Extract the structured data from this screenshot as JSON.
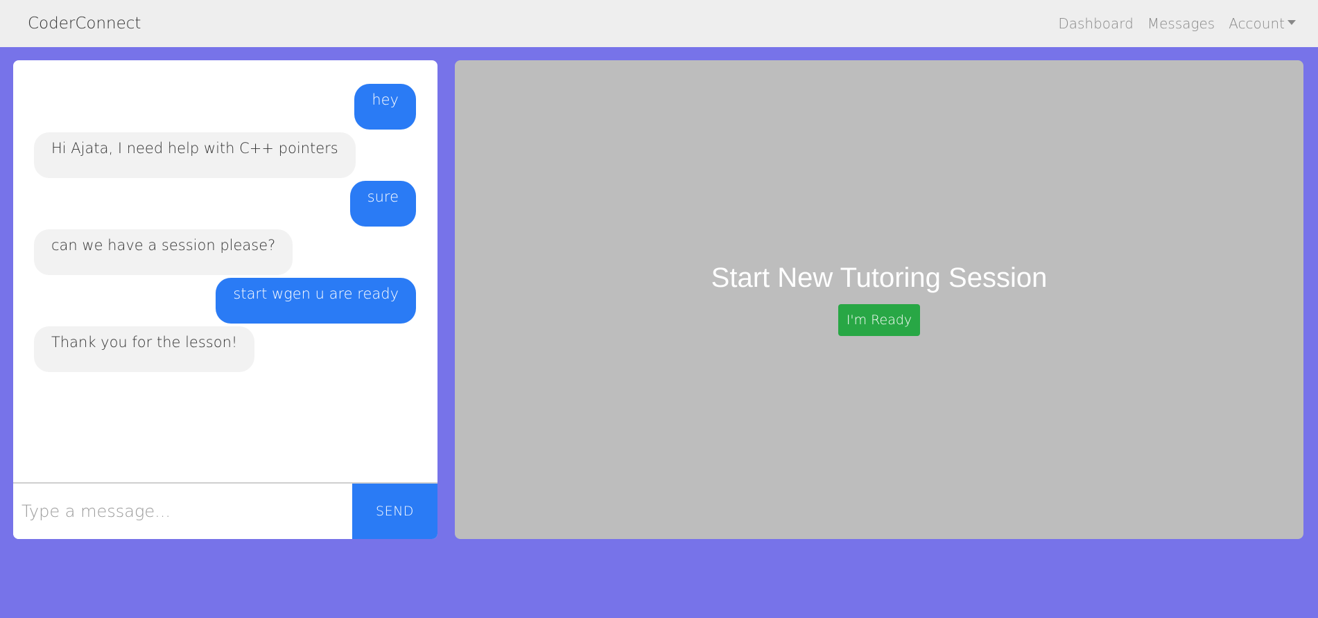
{
  "navbar": {
    "brand": "CoderConnect",
    "links": [
      "Dashboard",
      "Messages",
      "Account"
    ]
  },
  "chat": {
    "messages": [
      {
        "sender": "mine",
        "text": "hey"
      },
      {
        "sender": "theirs",
        "text": "Hi Ajata, I need help with C++ pointers"
      },
      {
        "sender": "mine",
        "text": "sure"
      },
      {
        "sender": "theirs",
        "text": "can we have a session please?"
      },
      {
        "sender": "mine",
        "text": "start wgen u are ready"
      },
      {
        "sender": "theirs",
        "text": "Thank you for the lesson!"
      }
    ],
    "input_placeholder": "Type a message...",
    "input_value": "",
    "send_label": "SEND"
  },
  "session": {
    "title": "Start New Tutoring Session",
    "ready_label": "I'm Ready"
  },
  "colors": {
    "background": "#7773e9",
    "navbar": "#eeeeee",
    "my_bubble": "#2a7bf5",
    "their_bubble": "#f2f2f2",
    "send_button": "#2a7bf5",
    "session_panel": "#bdbdbd",
    "ready_button": "#28a745"
  },
  "icons": {
    "account_dropdown": "caret-down-icon"
  }
}
